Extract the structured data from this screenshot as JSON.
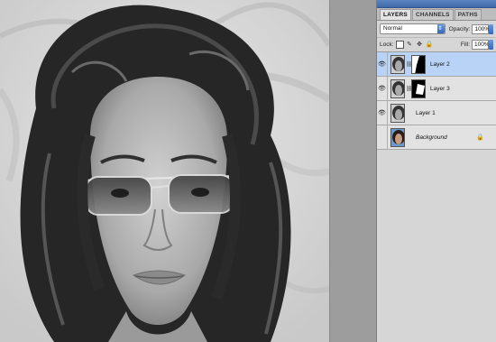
{
  "layers_panel": {
    "tabs": [
      {
        "label": "LAYERS",
        "active": true
      },
      {
        "label": "CHANNELS",
        "active": false
      },
      {
        "label": "PATHS",
        "active": false
      }
    ],
    "blend_mode": "Normal",
    "opacity_label": "Opacity:",
    "opacity_value": "100%",
    "lock_label": "Lock:",
    "fill_label": "Fill:",
    "fill_value": "100%",
    "layers": [
      {
        "name": "Layer 2",
        "visible": true,
        "selected": true,
        "has_mask": true
      },
      {
        "name": "Layer 3",
        "visible": true,
        "selected": false,
        "has_mask": true
      },
      {
        "name": "Layer 1",
        "visible": true,
        "selected": false,
        "has_mask": false
      },
      {
        "name": "Background",
        "visible": false,
        "selected": false,
        "has_mask": false,
        "locked": true
      }
    ]
  },
  "icons": {
    "eye": "eye-icon",
    "chain": "link-icon",
    "lock": "lock-icon",
    "move": "move-icon",
    "brush": "brush-icon",
    "transparency": "lock-transparency-icon"
  },
  "colors": {
    "selected_row": "#b9d3f6",
    "panel_header": "#4a76b5",
    "spinner_blue": "#2f66c2"
  }
}
